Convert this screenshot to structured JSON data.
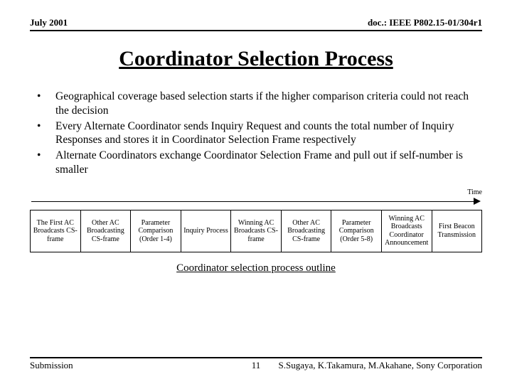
{
  "header": {
    "left": "July 2001",
    "right": "doc.: IEEE P802.15-01/304r1"
  },
  "title": "Coordinator Selection Process",
  "bullets": [
    "Geographical coverage based selection starts if the higher comparison criteria could not reach the decision",
    "Every Alternate Coordinator sends Inquiry Request and counts the total number of Inquiry Responses and stores it in Coordinator Selection Frame respectively",
    "Alternate Coordinators exchange Coordinator Selection Frame and pull out if self-number is smaller"
  ],
  "timeline": {
    "time_label": "Time",
    "boxes": [
      "The First AC Broadcasts CS-frame",
      "Other AC Broadcasting CS-frame",
      "Parameter Comparison (Order 1-4)",
      "Inquiry Process",
      "Winning AC Broadcasts CS-frame",
      "Other AC Broadcasting CS-frame",
      "Parameter Comparison (Order 5-8)",
      "Winning AC Broadcasts Coordinator Announcement",
      "First Beacon Transmission"
    ],
    "caption": "Coordinator selection process outline"
  },
  "footer": {
    "left": "Submission",
    "center": "11",
    "right": "S.Sugaya, K.Takamura, M.Akahane, Sony Corporation"
  }
}
